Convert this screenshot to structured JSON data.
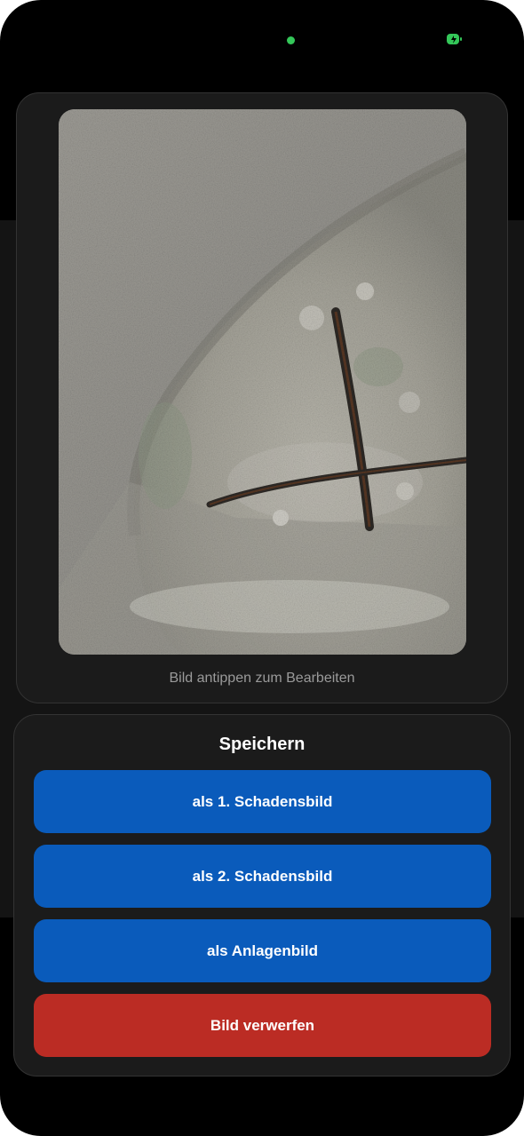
{
  "preview": {
    "hint": "Bild antippen zum Bearbeiten"
  },
  "save_sheet": {
    "title": "Speichern",
    "buttons": {
      "damage_image_1": "als 1. Schadensbild",
      "damage_image_2": "als 2. Schadensbild",
      "system_image": "als Anlagenbild",
      "discard": "Bild verwerfen"
    }
  },
  "colors": {
    "primary_button": "#0a5bbb",
    "destructive_button": "#bb2c24",
    "status_indicator": "#34c759"
  }
}
